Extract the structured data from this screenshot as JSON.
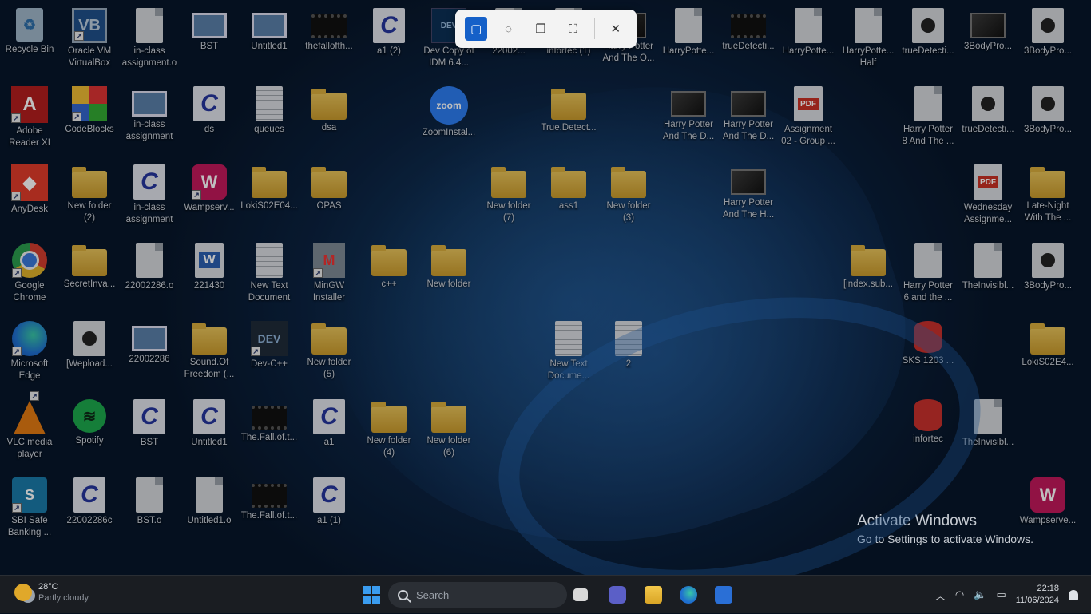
{
  "desktop": {
    "icons": [
      {
        "label": "Recycle Bin",
        "type": "recycle",
        "glyph": "♻"
      },
      {
        "label": "Oracle VM\nVirtualBox",
        "type": "vbox",
        "glyph": "VB",
        "shortcut": true
      },
      {
        "label": "in-class\nassignment.o",
        "type": "file"
      },
      {
        "label": "BST",
        "type": "img"
      },
      {
        "label": "Untitled1",
        "type": "img"
      },
      {
        "label": "thefallofth...",
        "type": "video"
      },
      {
        "label": "a1 (2)",
        "type": "c",
        "glyph": "C"
      },
      {
        "label": "Dev Copy of\nIDM 6.4...",
        "type": "devapp",
        "glyph": "DEV"
      },
      {
        "label": "22002...",
        "type": "file"
      },
      {
        "label": "infortec (1)",
        "type": "file"
      },
      {
        "label": "Harry Potter\nAnd The O...",
        "type": "film"
      },
      {
        "label": "HarryPotte...",
        "type": "file"
      },
      {
        "label": "trueDetecti...",
        "type": "video"
      },
      {
        "label": "HarryPotte...",
        "type": "file"
      },
      {
        "label": "HarryPotte...\nHalf",
        "type": "file"
      },
      {
        "label": "trueDetecti...",
        "type": "media"
      },
      {
        "label": "3BodyPro...",
        "type": "film"
      },
      {
        "label": "3BodyPro...",
        "type": "media"
      },
      {
        "label": "Adobe\nReader XI",
        "type": "acrobat",
        "glyph": "A",
        "shortcut": true
      },
      {
        "label": "CodeBlocks",
        "type": "codeblocks",
        "shortcut": true
      },
      {
        "label": "in-class\nassignment",
        "type": "img"
      },
      {
        "label": "ds",
        "type": "c",
        "glyph": "C"
      },
      {
        "label": "queues",
        "type": "text"
      },
      {
        "label": "dsa",
        "type": "folder"
      },
      {
        "label": "ZoomInstal...",
        "type": "zoom",
        "glyph": "zoom"
      },
      {
        "label": "True.Detect...",
        "type": "folder"
      },
      {
        "label": "Harry Potter\nAnd The D...",
        "type": "film"
      },
      {
        "label": "Harry Potter\nAnd The D...",
        "type": "film"
      },
      {
        "label": "Assignment\n02 - Group ...",
        "type": "pdf",
        "glyph": "PDF"
      },
      {
        "label": "Harry Potter\n8 And The ...",
        "type": "file"
      },
      {
        "label": "trueDetecti...",
        "type": "media"
      },
      {
        "label": "3BodyPro...",
        "type": "media"
      },
      {
        "label": "AnyDesk",
        "type": "anydesk",
        "glyph": "◆",
        "shortcut": true
      },
      {
        "label": "New folder\n(2)",
        "type": "folder"
      },
      {
        "label": "in-class\nassignment",
        "type": "c",
        "glyph": "C"
      },
      {
        "label": "Wampserv...",
        "type": "wamp",
        "glyph": "W",
        "shortcut": true
      },
      {
        "label": "LokiS02E04...",
        "type": "folder"
      },
      {
        "label": "OPAS",
        "type": "folder"
      },
      {
        "label": "New folder\n(7)",
        "type": "folder"
      },
      {
        "label": "ass1",
        "type": "folder"
      },
      {
        "label": "New folder\n(3)",
        "type": "folder"
      },
      {
        "label": "Harry Potter\nAnd The H...",
        "type": "film"
      },
      {
        "label": "Wednesday\nAssignme...",
        "type": "pdf",
        "glyph": "PDF"
      },
      {
        "label": "Late-Night\nWith The ...",
        "type": "folder"
      },
      {
        "label": "Google\nChrome",
        "type": "chrome",
        "shortcut": true
      },
      {
        "label": "SecretInva...",
        "type": "folder"
      },
      {
        "label": "22002286.o",
        "type": "file"
      },
      {
        "label": "221430",
        "type": "word",
        "glyph": "W"
      },
      {
        "label": "New Text\nDocument",
        "type": "text"
      },
      {
        "label": "MinGW\nInstaller",
        "type": "mingw",
        "glyph": "M",
        "shortcut": true
      },
      {
        "label": "c++",
        "type": "folder"
      },
      {
        "label": "New folder",
        "type": "folder"
      },
      {
        "label": "[index.sub...",
        "type": "folder"
      },
      {
        "label": "Harry Potter\n6 and the ...",
        "type": "file"
      },
      {
        "label": "TheInvisibl...",
        "type": "file"
      },
      {
        "label": "3BodyPro...",
        "type": "media"
      },
      {
        "label": "Microsoft\nEdge",
        "type": "edge",
        "shortcut": true
      },
      {
        "label": "[Wepload...",
        "type": "media"
      },
      {
        "label": "22002286",
        "type": "img"
      },
      {
        "label": "Sound.Of\nFreedom (...",
        "type": "folder"
      },
      {
        "label": "Dev-C++",
        "type": "dev",
        "glyph": "DEV",
        "shortcut": true
      },
      {
        "label": "New folder\n(5)",
        "type": "folder"
      },
      {
        "label": "New Text\nDocume...",
        "type": "text"
      },
      {
        "label": "2",
        "type": "text"
      },
      {
        "label": "SKS 1203 ...",
        "type": "db"
      },
      {
        "label": "LokiS02E4...",
        "type": "folder"
      },
      {
        "label": "VLC media\nplayer",
        "type": "vlc",
        "shortcut": true
      },
      {
        "label": "Spotify",
        "type": "spotify",
        "glyph": "≋"
      },
      {
        "label": "BST",
        "type": "c",
        "glyph": "C"
      },
      {
        "label": "Untitled1",
        "type": "c",
        "glyph": "C"
      },
      {
        "label": "The.Fall.of.t...",
        "type": "video"
      },
      {
        "label": "a1",
        "type": "c",
        "glyph": "C"
      },
      {
        "label": "New folder\n(4)",
        "type": "folder"
      },
      {
        "label": "New folder\n(6)",
        "type": "folder"
      },
      {
        "label": "infortec",
        "type": "db"
      },
      {
        "label": "TheInvisibl...",
        "type": "file"
      },
      {
        "label": "SBI Safe\nBanking ...",
        "type": "sbi",
        "glyph": "S",
        "shortcut": true
      },
      {
        "label": "22002286c",
        "type": "c",
        "glyph": "C"
      },
      {
        "label": "BST.o",
        "type": "file"
      },
      {
        "label": "Untitled1.o",
        "type": "file"
      },
      {
        "label": "The.Fall.of.t...",
        "type": "video"
      },
      {
        "label": "a1 (1)",
        "type": "c",
        "glyph": "C"
      },
      {
        "label": "Wampserve...",
        "type": "wamp",
        "glyph": "W"
      }
    ]
  },
  "snip_toolbar": {
    "modes": [
      {
        "name": "rectangle-mode",
        "glyph": "▢"
      },
      {
        "name": "freeform-mode",
        "glyph": "◌"
      },
      {
        "name": "window-mode",
        "glyph": "❐"
      },
      {
        "name": "fullscreen-mode",
        "glyph": "⛶"
      }
    ],
    "close_glyph": "✕"
  },
  "watermark": {
    "title": "Activate Windows",
    "subtitle": "Go to Settings to activate Windows."
  },
  "taskbar": {
    "weather": {
      "temp": "28°C",
      "condition": "Partly cloudy"
    },
    "search_placeholder": "Search",
    "clock": {
      "time": "22:18",
      "date": "11/06/2024"
    },
    "tray": {
      "chevron": "︿",
      "wifi": "◠",
      "volume": "🔈",
      "battery": "▭"
    }
  },
  "colors": {
    "accent": "#1560c8",
    "taskbar_bg": "#1a1d22",
    "desktop_dim": "#06101d"
  }
}
